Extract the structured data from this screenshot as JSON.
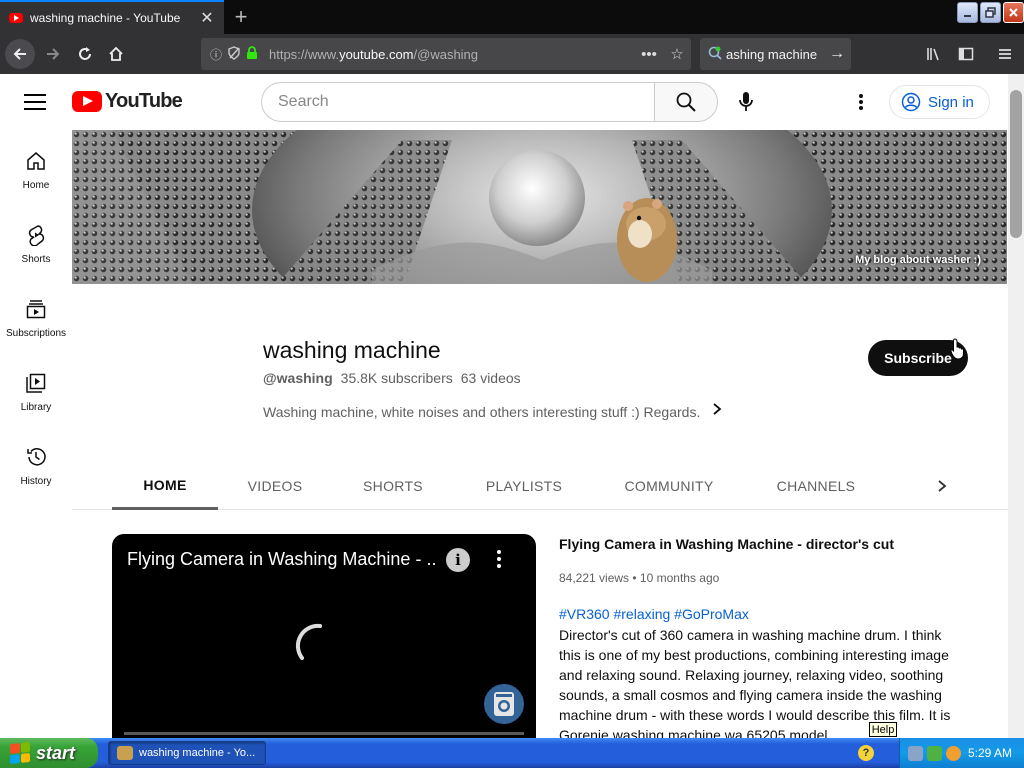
{
  "browser": {
    "tab_title": "washing machine - YouTube",
    "tab_close": "✕",
    "new_tab": "+",
    "url_prefix": "https://www.",
    "url_domain": "youtube.com",
    "url_path": "/@washing",
    "search_text": "ashing machine",
    "search_go": "→"
  },
  "youtube": {
    "logo_text": "YouTube",
    "search_placeholder": "Search",
    "sign_in": "Sign in",
    "guide": [
      {
        "label": "Home",
        "icon": "home-icon"
      },
      {
        "label": "Shorts",
        "icon": "shorts-icon"
      },
      {
        "label": "Subscriptions",
        "icon": "subscriptions-icon"
      },
      {
        "label": "Library",
        "icon": "library-icon"
      },
      {
        "label": "History",
        "icon": "history-icon"
      }
    ],
    "banner_link": "My blog about washer :)",
    "channel": {
      "name": "washing machine",
      "handle": "@washing",
      "subscribers": "35.8K subscribers",
      "videos": "63 videos",
      "description": "Washing machine, white noises and others interesting stuff :) Regards.",
      "subscribe_label": "Subscribe"
    },
    "tabs": [
      {
        "label": "HOME",
        "active": true
      },
      {
        "label": "VIDEOS",
        "active": false
      },
      {
        "label": "SHORTS",
        "active": false
      },
      {
        "label": "PLAYLISTS",
        "active": false
      },
      {
        "label": "COMMUNITY",
        "active": false
      },
      {
        "label": "CHANNELS",
        "active": false
      }
    ],
    "featured": {
      "player_title": "Flying Camera in Washing Machine - ...",
      "title": "Flying Camera in Washing Machine - director's cut",
      "stats": "84,221 views • 10 months ago",
      "tags": "#VR360 #relaxing #GoProMax",
      "description": "Director's cut of 360 camera in washing machine drum. I think this is one of my best productions, combining interesting image and relaxing sound. Relaxing journey, relaxing video, soothing sounds, a small cosmos and flying camera inside the washing machine drum - with these words I would describe this film. It is Gorenje washing machine wa 65205 model"
    },
    "tooltip": "Help"
  },
  "taskbar": {
    "start_label": "start",
    "task_label": "washing machine - Yo...",
    "clock": "5:29 AM",
    "help_glyph": "?"
  },
  "colors": {
    "youtube_red": "#ff0000",
    "link_blue": "#065fd4",
    "firefox_dark": "#323234",
    "xp_blue": "#245edb",
    "xp_green": "#37a337"
  }
}
